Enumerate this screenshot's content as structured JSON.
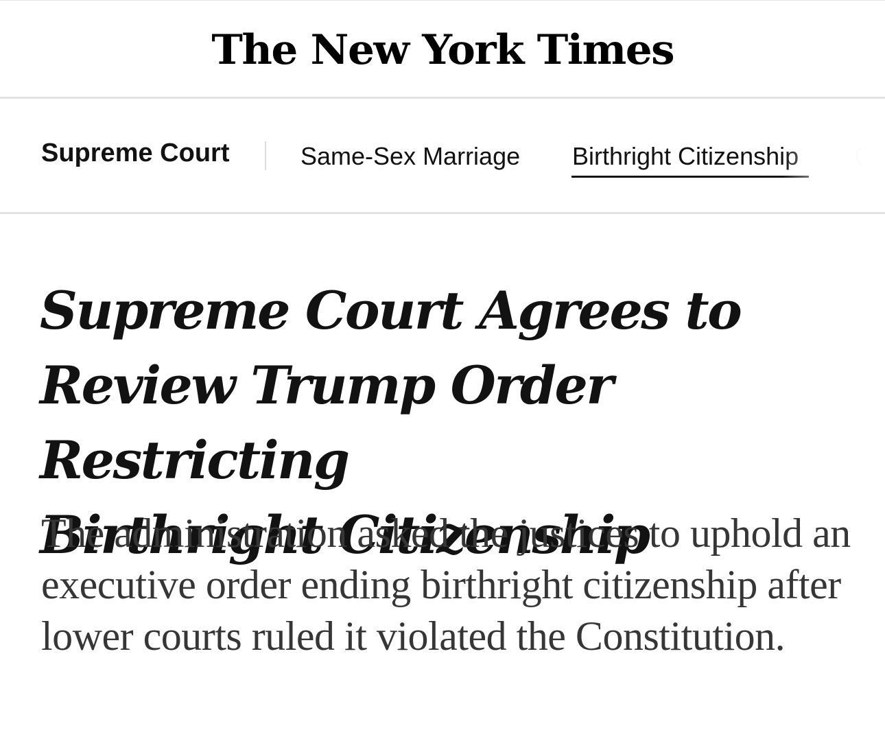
{
  "masthead": {
    "logo_text": "The New York Times"
  },
  "section_nav": {
    "section_title": "Supreme Court",
    "items": [
      {
        "label": "Same-Sex Marriage",
        "active": false
      },
      {
        "label": "Birthright Citizenship",
        "active": true
      },
      {
        "label": "Ch",
        "active": false
      }
    ]
  },
  "article": {
    "headline_lines": [
      "Supreme Court Agrees to",
      "Review Trump Order Restricting",
      "Birthright Citizenship"
    ],
    "summary": "The administration asked the justices to uphold an executive order ending birthright citizenship after lower courts ruled it violated the Constitution."
  },
  "colors": {
    "text": "#121212",
    "summary_text": "#363636",
    "rule": "#e2e2e2",
    "faded_nav_item": "#c4c4c4"
  }
}
